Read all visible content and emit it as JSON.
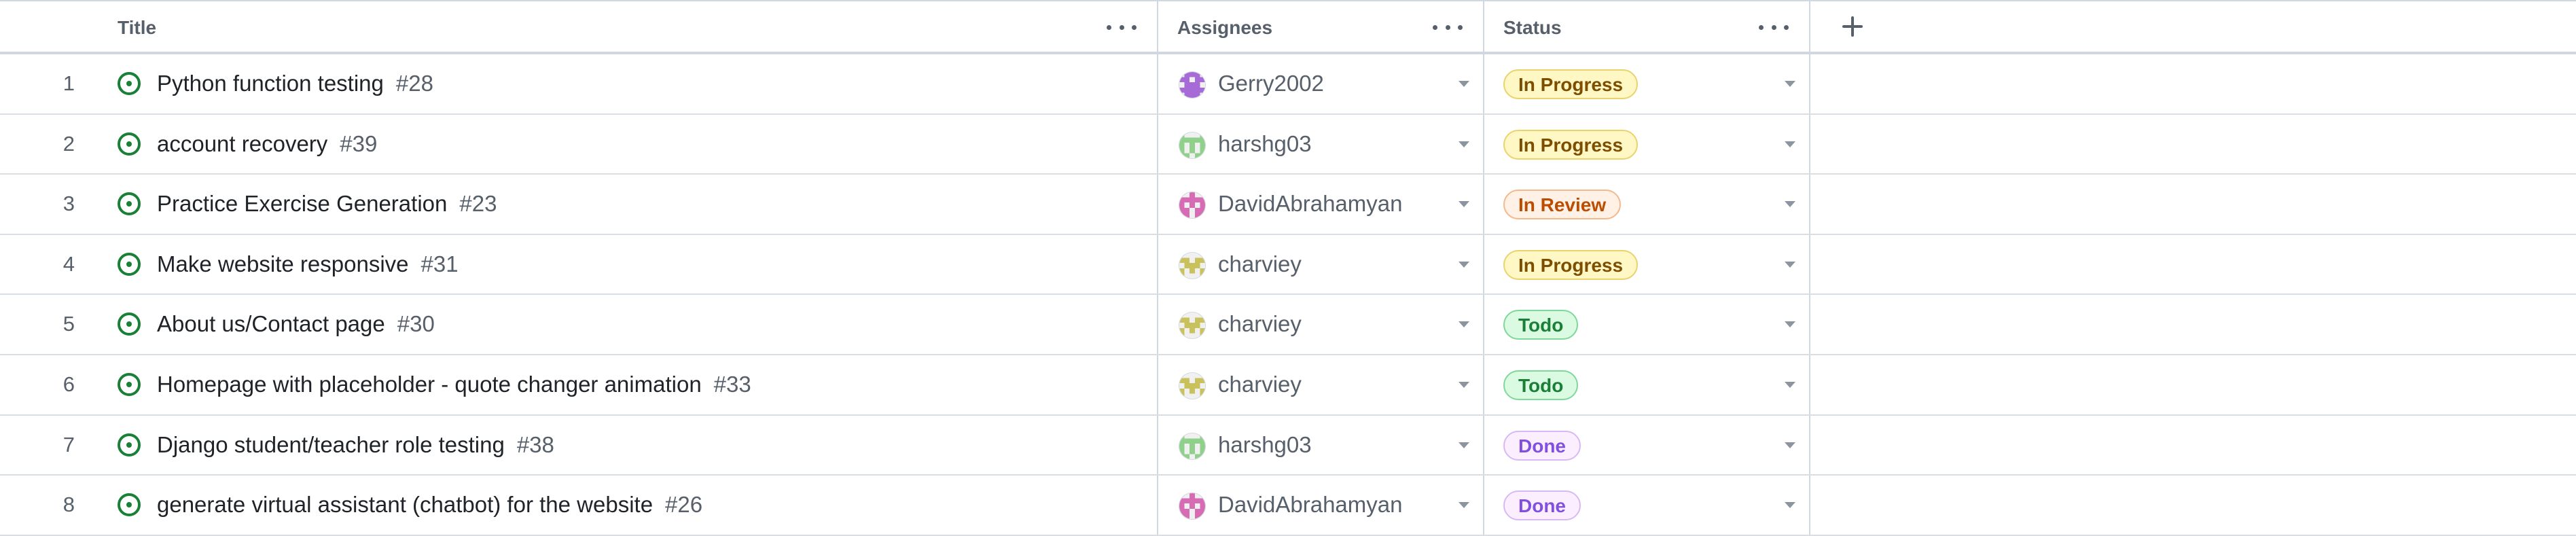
{
  "columns": {
    "title": "Title",
    "assignees": "Assignees",
    "status": "Status"
  },
  "statuses": {
    "In Progress": {
      "bg": "#fff8c5",
      "border": "#e9d36a",
      "color": "#7d4e00"
    },
    "In Review": {
      "bg": "#fff1e5",
      "border": "#f3b98c",
      "color": "#bc4c00"
    },
    "Todo": {
      "bg": "#dafbe1",
      "border": "#7fd89a",
      "color": "#1a7f37"
    },
    "Done": {
      "bg": "#fbefff",
      "border": "#d8b9f5",
      "color": "#8250df"
    }
  },
  "rows": [
    {
      "num": "1",
      "title": "Python function testing",
      "issue": "#28",
      "assignee": "Gerry2002",
      "avatar": "gerry-identicon",
      "status": "In Progress"
    },
    {
      "num": "2",
      "title": "account recovery",
      "issue": "#39",
      "assignee": "harshg03",
      "avatar": "harshg-identicon",
      "status": "In Progress"
    },
    {
      "num": "3",
      "title": "Practice Exercise Generation",
      "issue": "#23",
      "assignee": "DavidAbrahamyan",
      "avatar": "david-identicon",
      "status": "In Review"
    },
    {
      "num": "4",
      "title": "Make website responsive",
      "issue": "#31",
      "assignee": "charviey",
      "avatar": "charviey-identicon",
      "status": "In Progress"
    },
    {
      "num": "5",
      "title": "About us/Contact page",
      "issue": "#30",
      "assignee": "charviey",
      "avatar": "charviey-identicon",
      "status": "Todo"
    },
    {
      "num": "6",
      "title": "Homepage with placeholder - quote changer animation",
      "issue": "#33",
      "assignee": "charviey",
      "avatar": "charviey-identicon",
      "status": "Todo"
    },
    {
      "num": "7",
      "title": "Django student/teacher role testing",
      "issue": "#38",
      "assignee": "harshg03",
      "avatar": "harshg-identicon",
      "status": "Done"
    },
    {
      "num": "8",
      "title": "generate virtual assistant (chatbot) for the website",
      "issue": "#26",
      "assignee": "DavidAbrahamyan",
      "avatar": "david-identicon",
      "status": "Done"
    }
  ]
}
